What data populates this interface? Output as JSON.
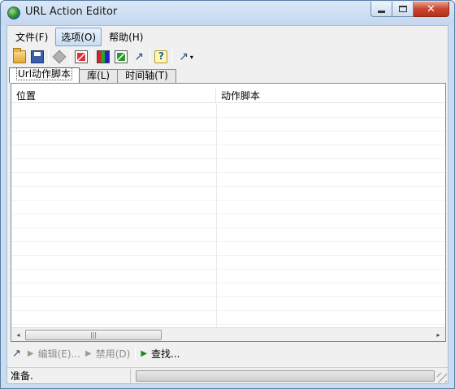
{
  "window": {
    "title": "URL Action Editor",
    "app_icon": "globe-icon"
  },
  "menu": {
    "file": "文件(F)",
    "options": "选项(O)",
    "help": "帮助(H)"
  },
  "toolbar": {
    "icons": [
      "open-folder-icon",
      "save-icon",
      "diamond-icon",
      "test-icon",
      "grid-icon",
      "check-icon",
      "arrow-icon",
      "help-icon",
      "arrow-dropdown-icon"
    ],
    "arrow_glyph": "↗",
    "dropdown_glyph": "▾"
  },
  "tabs": {
    "url_actions": "Url动作脚本",
    "library": "库(L)",
    "timeline": "时间轴(T)"
  },
  "list": {
    "columns": [
      "位置",
      "动作脚本"
    ],
    "rows": []
  },
  "scrollbar": {
    "left_arrow": "◂",
    "right_arrow": "▸",
    "thumb_grip": "|||"
  },
  "actions": {
    "edit_icon_glyph": "↗",
    "edit": "编辑(E)...",
    "disable": "禁用(D)",
    "find": "查找...",
    "triangle": "▶"
  },
  "status": {
    "text": "准备."
  },
  "colors": {
    "accent": "#1f5fa8",
    "enabled_green": "#1e8a1e",
    "close_red": "#c9462c"
  }
}
